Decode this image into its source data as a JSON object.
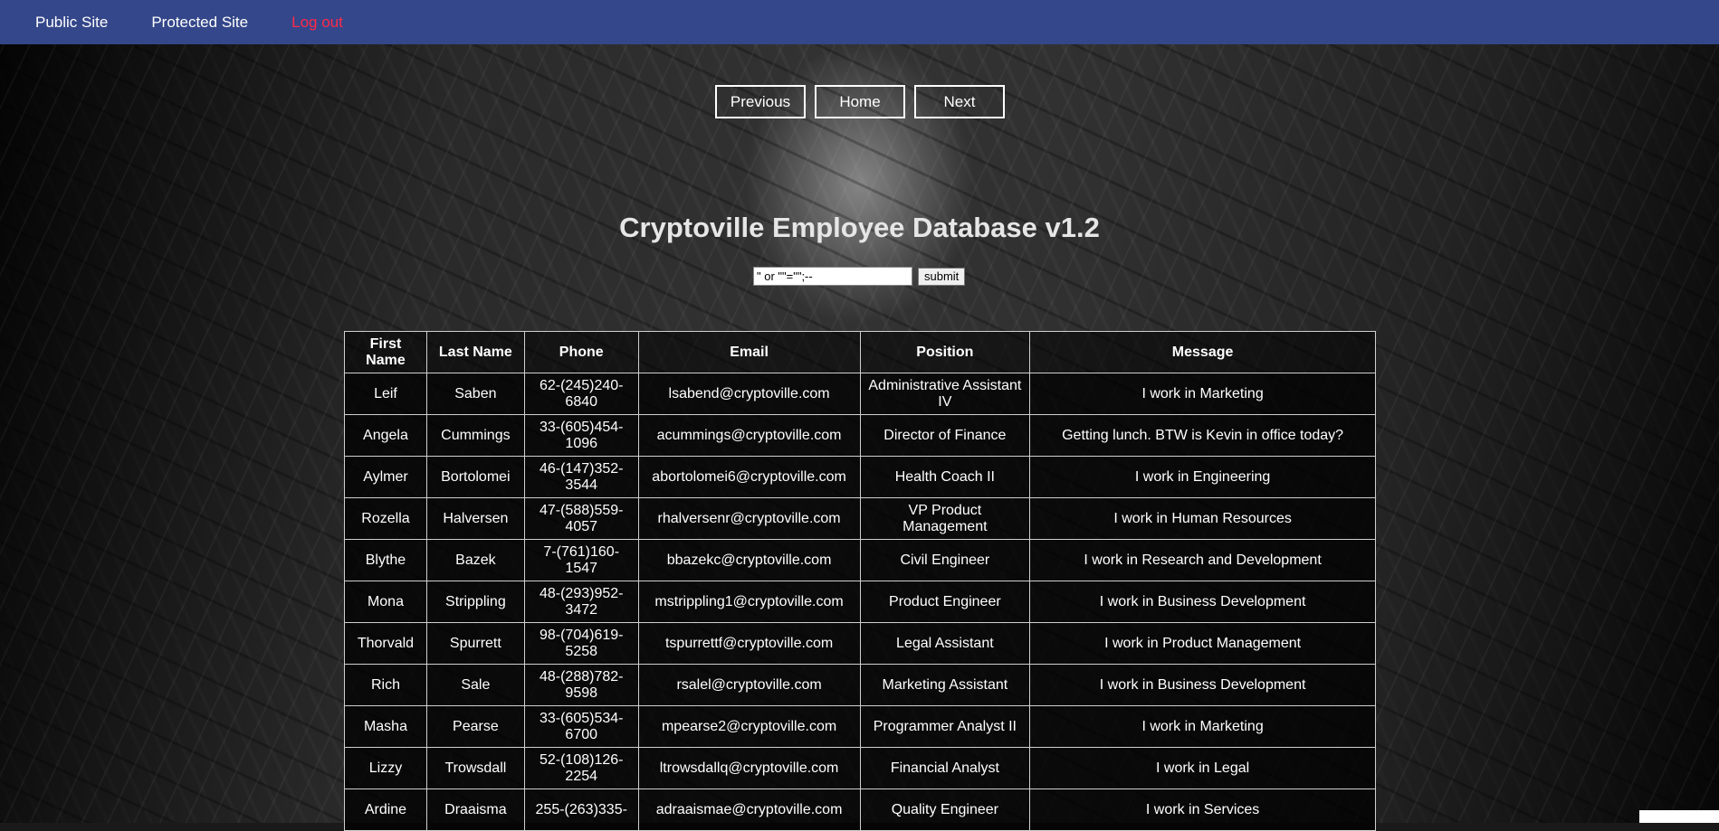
{
  "nav": {
    "public": "Public Site",
    "protected": "Protected Site",
    "logout": "Log out"
  },
  "pager": {
    "previous": "Previous",
    "home": "Home",
    "next": "Next"
  },
  "title": "Cryptoville Employee Database v1.2",
  "search": {
    "value": "\" or \"\"=\"\";--",
    "submit": "submit"
  },
  "table": {
    "headers": [
      "First Name",
      "Last Name",
      "Phone",
      "Email",
      "Position",
      "Message"
    ],
    "rows": [
      [
        "Leif",
        "Saben",
        "62-(245)240-6840",
        "lsabend@cryptoville.com",
        "Administrative Assistant IV",
        "I work in Marketing"
      ],
      [
        "Angela",
        "Cummings",
        "33-(605)454-1096",
        "acummings@cryptoville.com",
        "Director of Finance",
        "Getting lunch. BTW is Kevin in office today?"
      ],
      [
        "Aylmer",
        "Bortolomei",
        "46-(147)352-3544",
        "abortolomei6@cryptoville.com",
        "Health Coach II",
        "I work in Engineering"
      ],
      [
        "Rozella",
        "Halversen",
        "47-(588)559-4057",
        "rhalversenr@cryptoville.com",
        "VP Product Management",
        "I work in Human Resources"
      ],
      [
        "Blythe",
        "Bazek",
        "7-(761)160-1547",
        "bbazekc@cryptoville.com",
        "Civil Engineer",
        "I work in Research and Development"
      ],
      [
        "Mona",
        "Strippling",
        "48-(293)952-3472",
        "mstrippling1@cryptoville.com",
        "Product Engineer",
        "I work in Business Development"
      ],
      [
        "Thorvald",
        "Spurrett",
        "98-(704)619-5258",
        "tspurrettf@cryptoville.com",
        "Legal Assistant",
        "I work in Product Management"
      ],
      [
        "Rich",
        "Sale",
        "48-(288)782-9598",
        "rsalel@cryptoville.com",
        "Marketing Assistant",
        "I work in Business Development"
      ],
      [
        "Masha",
        "Pearse",
        "33-(605)534-6700",
        "mpearse2@cryptoville.com",
        "Programmer Analyst II",
        "I work in Marketing"
      ],
      [
        "Lizzy",
        "Trowsdall",
        "52-(108)126-2254",
        "ltrowsdallq@cryptoville.com",
        "Financial Analyst",
        "I work in Legal"
      ],
      [
        "Ardine",
        "Draaisma",
        "255-(263)335-",
        "adraaismae@cryptoville.com",
        "Quality Engineer",
        "I work in Services"
      ]
    ]
  }
}
